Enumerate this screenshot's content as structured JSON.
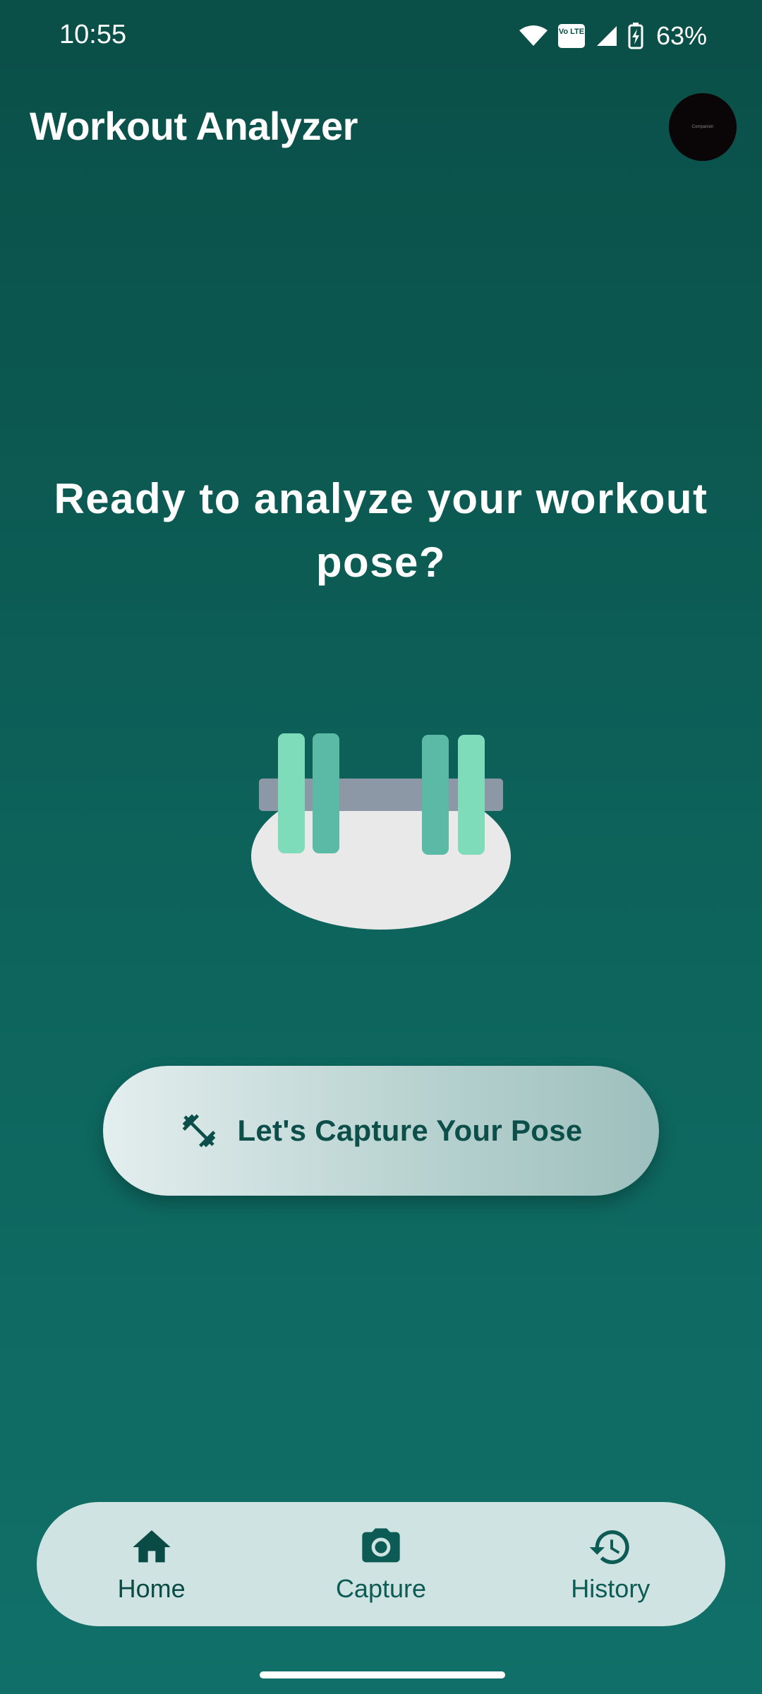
{
  "status_bar": {
    "time": "10:55",
    "battery": "63%",
    "network_badge": "Vo LTE",
    "icons": [
      "wifi-icon",
      "volte-icon",
      "signal-icon",
      "battery-charging-icon"
    ]
  },
  "app_bar": {
    "title": "Workout Analyzer",
    "avatar_text": "Companion"
  },
  "main": {
    "headline": "Ready to analyze your workout pose?",
    "cta_label": "Let's Capture Your Pose",
    "cta_icon": "dumbbell-icon"
  },
  "bottom_nav": {
    "items": [
      {
        "label": "Home",
        "icon": "home-icon",
        "active": true
      },
      {
        "label": "Capture",
        "icon": "camera-icon",
        "active": false
      },
      {
        "label": "History",
        "icon": "history-icon",
        "active": false
      }
    ]
  },
  "colors": {
    "background_top": "#0a4f48",
    "background_bottom": "#107069",
    "accent_dark": "#0c4e49",
    "nav_bg": "#cfe3e2",
    "plate_light": "#7fdcba",
    "plate_dark": "#5bbaa5",
    "bar": "#8d98a6",
    "mat": "#e9e9e9"
  }
}
